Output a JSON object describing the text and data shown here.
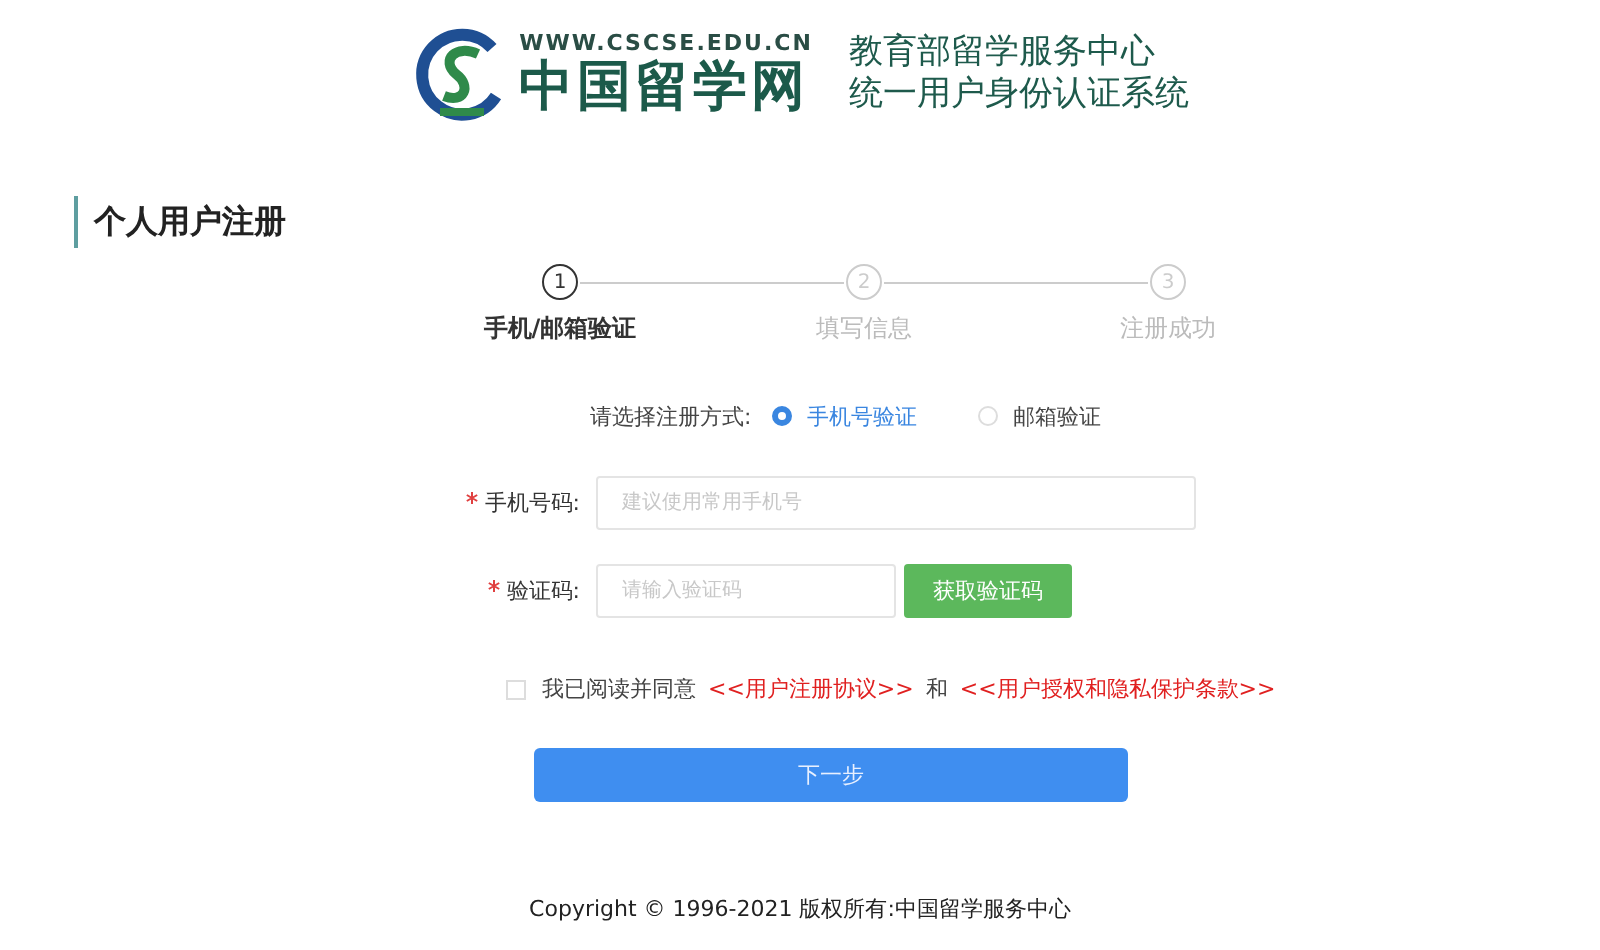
{
  "header": {
    "site_url": "WWW.CSCSE.EDU.CN",
    "site_name": "中国留学网",
    "title_lines": [
      "教育部留学服务中心",
      "统一用户身份认证系统"
    ]
  },
  "page_title": "个人用户注册",
  "steps": [
    {
      "number": "1",
      "label": "手机/邮箱验证",
      "selected": true
    },
    {
      "number": "2",
      "label": "填写信息",
      "selected": false
    },
    {
      "number": "3",
      "label": "注册成功",
      "selected": false
    }
  ],
  "method": {
    "label": "请选择注册方式:",
    "options": [
      {
        "label": "手机号验证",
        "selected": true
      },
      {
        "label": "邮箱验证",
        "selected": false
      }
    ]
  },
  "fields": [
    {
      "label": "手机号码:",
      "required": true,
      "placeholder": "建议使用常用手机号"
    },
    {
      "label": "验证码:",
      "required": true,
      "placeholder": "请输入验证码",
      "button": "获取验证码"
    }
  ],
  "agreement": {
    "checked": false,
    "text": "我已阅读并同意",
    "link_1": "<<用户注册协议>>",
    "conjunction": "和",
    "link_2": "<<用户授权和隐私保护条款>>"
  },
  "next_button": "下一步",
  "copyright": "Copyright © 1996-2021 版权所有:中国留学服务中心"
}
